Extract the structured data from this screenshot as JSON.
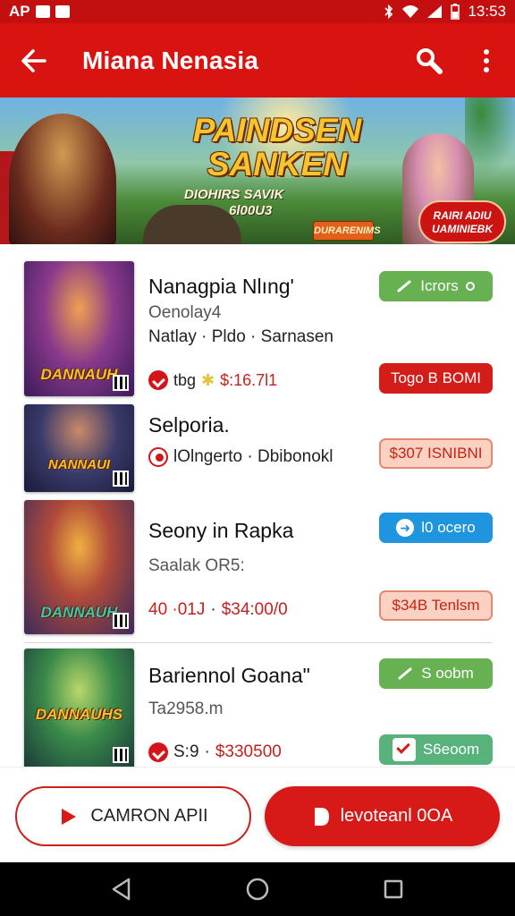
{
  "statusbar": {
    "carrier": "AP",
    "time": "13:53"
  },
  "appbar": {
    "title": "Miana Nenasia"
  },
  "banner": {
    "title_line1": "PAINDSEN",
    "title_line2": "SANKEN",
    "subtitle_line1": "DIOHIRS SAVIK",
    "subtitle_line2": "6l00U3",
    "tag": "DURARENIMS",
    "badge_line1": "RAIRI ADIU",
    "badge_line2": "UAMINIEBK"
  },
  "games": [
    {
      "name": "Nanagpia Nlıng'",
      "meta1": "Oenolay4",
      "meta2": "Natlay · Pldo · Sarnasen",
      "price_prefix": "tbg",
      "price": "$:16.7l1",
      "thumb_logo": "DANNAUH",
      "action_label": "Icrors",
      "price_button": "Togo B BOMI"
    },
    {
      "name": "Selporia.",
      "meta1": "lOlngerto · Dbibonokl",
      "thumb_logo": "NANNAUI",
      "price_button": "$307 ISNIBNI"
    },
    {
      "name": "Seony in Rapka",
      "meta1": "Saalak OR5:",
      "price_prefix": "40 ·01J",
      "price": "$34:00/0",
      "thumb_logo": "DANNAUH",
      "action_label": "l0 ocero",
      "price_button": "$34B Tenlsm"
    },
    {
      "name": "Bariennol Goana\"",
      "meta1": "Ta2958.m",
      "price_prefix": "S:9",
      "price": "$330500",
      "thumb_logo": "DANNAUHS",
      "action_label": "S oobm",
      "price_button": "S6eoom"
    }
  ],
  "bottom": {
    "left_button": "CAMRON APII",
    "right_button": "levoteanl 0OA"
  },
  "colors": {
    "primary": "#d9130f",
    "green": "#67b153",
    "blue": "#1e95de",
    "peach": "#fbd2c2"
  }
}
